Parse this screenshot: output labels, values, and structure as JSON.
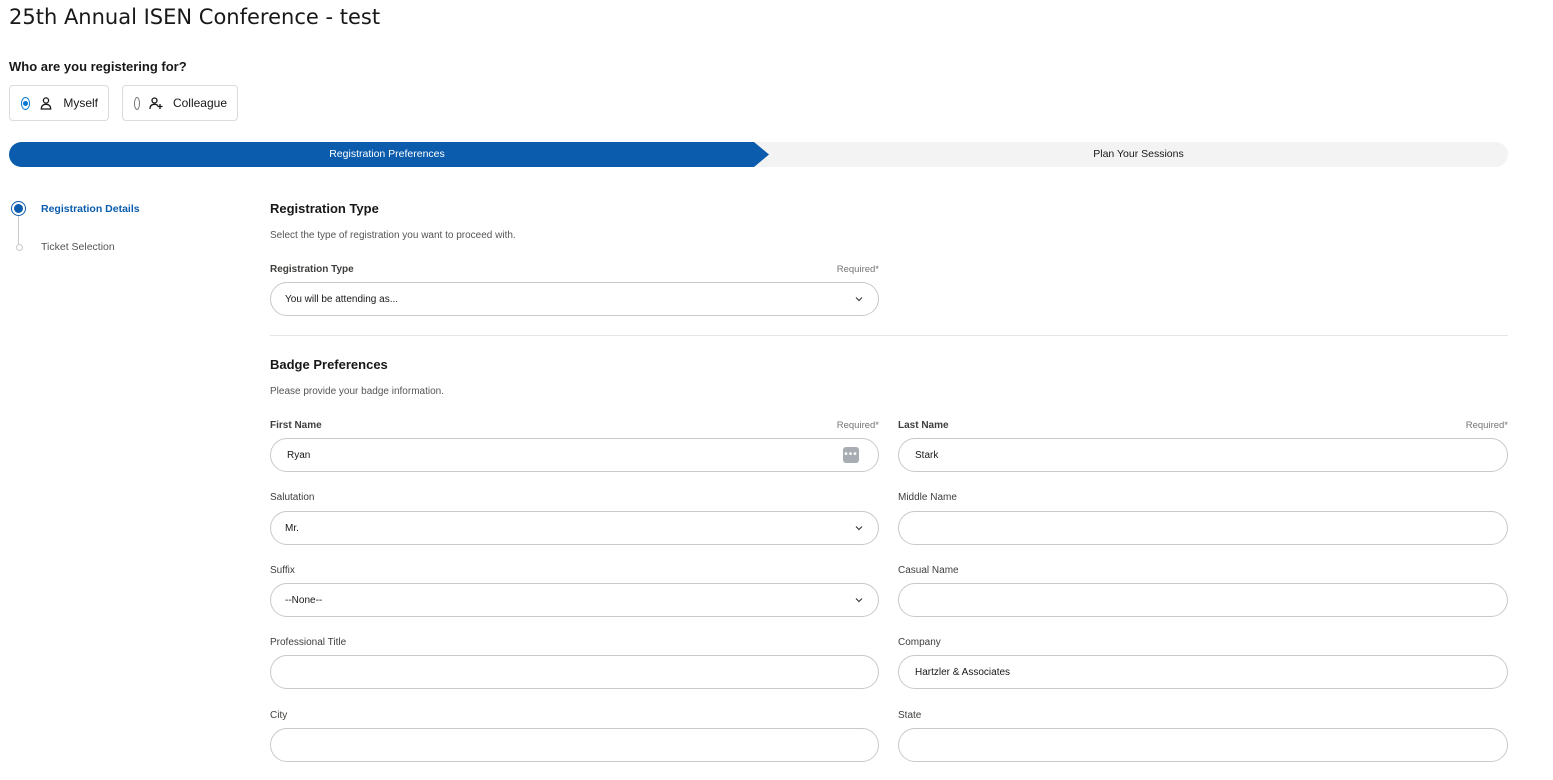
{
  "page": {
    "title": "25th Annual ISEN Conference - test"
  },
  "registering_for": {
    "question": "Who are you registering for?",
    "options": [
      {
        "label": "Myself",
        "icon": "person-icon",
        "selected": true
      },
      {
        "label": "Colleague",
        "icon": "person-add-icon",
        "selected": false
      }
    ]
  },
  "path": {
    "steps": [
      {
        "label": "Registration Preferences",
        "active": true
      },
      {
        "label": "Plan Your Sessions",
        "active": false
      }
    ]
  },
  "sidebar": {
    "steps": [
      {
        "label": "Registration Details",
        "active": true
      },
      {
        "label": "Ticket Selection",
        "active": false
      }
    ]
  },
  "registration_type": {
    "title": "Registration Type",
    "description": "Select the type of registration you want to proceed with.",
    "field_label": "Registration Type",
    "required": "Required*",
    "value": "You will be attending as..."
  },
  "badge": {
    "title": "Badge Preferences",
    "description": "Please provide your badge information.",
    "first_name": {
      "label": "First Name",
      "required": "Required*",
      "value": "Ryan"
    },
    "last_name": {
      "label": "Last Name",
      "required": "Required*",
      "value": "Stark"
    },
    "salutation": {
      "label": "Salutation",
      "value": "Mr."
    },
    "middle_name": {
      "label": "Middle Name",
      "value": ""
    },
    "suffix": {
      "label": "Suffix",
      "value": "--None--"
    },
    "casual_name": {
      "label": "Casual Name",
      "value": ""
    },
    "professional_title": {
      "label": "Professional Title",
      "value": ""
    },
    "company": {
      "label": "Company",
      "value": "Hartzler & Associates"
    },
    "city": {
      "label": "City",
      "value": ""
    },
    "state": {
      "label": "State",
      "value": ""
    }
  },
  "colors": {
    "brand": "#0b5cad",
    "radio": "#0176d3",
    "border": "#c9c9c9"
  }
}
